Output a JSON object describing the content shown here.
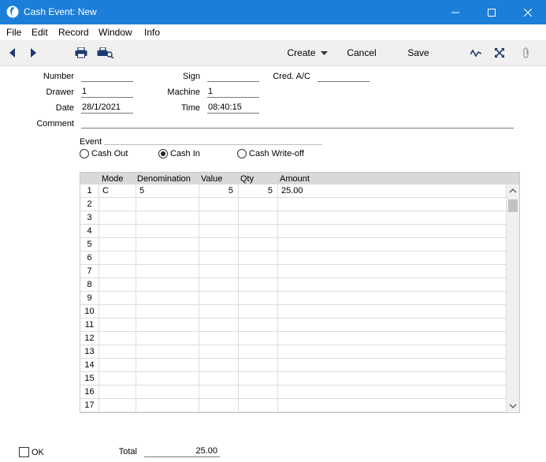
{
  "window": {
    "title": "Cash Event: New"
  },
  "menu": [
    "File",
    "Edit",
    "Record",
    "Window",
    "Info"
  ],
  "toolbar": {
    "create": "Create",
    "cancel": "Cancel",
    "save": "Save"
  },
  "form": {
    "number_label": "Number",
    "number_value": "",
    "sign_label": "Sign",
    "sign_value": "",
    "cred_label": "Cred. A/C",
    "cred_value": "",
    "drawer_label": "Drawer",
    "drawer_value": "1",
    "machine_label": "Machine",
    "machine_value": "1",
    "date_label": "Date",
    "date_value": "28/1/2021",
    "time_label": "Time",
    "time_value": "08:40:15",
    "comment_label": "Comment",
    "comment_value": "",
    "event_label": "Event",
    "event_options": [
      "Cash Out",
      "Cash In",
      "Cash Write-off"
    ],
    "event_selected": "Cash In"
  },
  "grid": {
    "columns": [
      "Mode",
      "Denomination",
      "Value",
      "Qty",
      "Amount"
    ],
    "rows": [
      {
        "n": "1",
        "mode": "C",
        "denomination": "5",
        "value": "5",
        "qty": "5",
        "amount": "25.00"
      },
      {
        "n": "2",
        "mode": "",
        "denomination": "",
        "value": "",
        "qty": "",
        "amount": ""
      },
      {
        "n": "3",
        "mode": "",
        "denomination": "",
        "value": "",
        "qty": "",
        "amount": ""
      },
      {
        "n": "4",
        "mode": "",
        "denomination": "",
        "value": "",
        "qty": "",
        "amount": ""
      },
      {
        "n": "5",
        "mode": "",
        "denomination": "",
        "value": "",
        "qty": "",
        "amount": ""
      },
      {
        "n": "6",
        "mode": "",
        "denomination": "",
        "value": "",
        "qty": "",
        "amount": ""
      },
      {
        "n": "7",
        "mode": "",
        "denomination": "",
        "value": "",
        "qty": "",
        "amount": ""
      },
      {
        "n": "8",
        "mode": "",
        "denomination": "",
        "value": "",
        "qty": "",
        "amount": ""
      },
      {
        "n": "9",
        "mode": "",
        "denomination": "",
        "value": "",
        "qty": "",
        "amount": ""
      },
      {
        "n": "10",
        "mode": "",
        "denomination": "",
        "value": "",
        "qty": "",
        "amount": ""
      },
      {
        "n": "11",
        "mode": "",
        "denomination": "",
        "value": "",
        "qty": "",
        "amount": ""
      },
      {
        "n": "12",
        "mode": "",
        "denomination": "",
        "value": "",
        "qty": "",
        "amount": ""
      },
      {
        "n": "13",
        "mode": "",
        "denomination": "",
        "value": "",
        "qty": "",
        "amount": ""
      },
      {
        "n": "14",
        "mode": "",
        "denomination": "",
        "value": "",
        "qty": "",
        "amount": ""
      },
      {
        "n": "15",
        "mode": "",
        "denomination": "",
        "value": "",
        "qty": "",
        "amount": ""
      },
      {
        "n": "16",
        "mode": "",
        "denomination": "",
        "value": "",
        "qty": "",
        "amount": ""
      },
      {
        "n": "17",
        "mode": "",
        "denomination": "",
        "value": "",
        "qty": "",
        "amount": ""
      }
    ]
  },
  "footer": {
    "ok_label": "OK",
    "total_label": "Total",
    "total_value": "25.00"
  }
}
